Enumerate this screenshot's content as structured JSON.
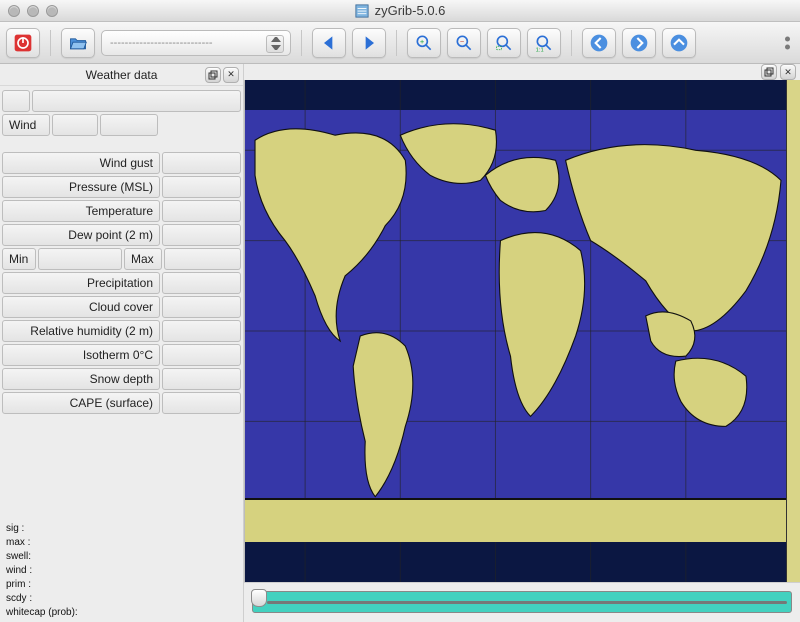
{
  "window": {
    "title": "zyGrib-5.0.6"
  },
  "toolbar": {
    "combo_placeholder": "----------------------------"
  },
  "sidebar": {
    "title": "Weather data",
    "rows": [
      {
        "label": "Wind"
      },
      {
        "label": "Wind gust"
      },
      {
        "label": "Pressure (MSL)"
      },
      {
        "label": "Temperature"
      },
      {
        "label": "Dew point (2 m)"
      },
      {
        "min_label": "Min",
        "max_label": "Max"
      },
      {
        "label": "Precipitation"
      },
      {
        "label": "Cloud cover"
      },
      {
        "label": "Relative humidity (2 m)"
      },
      {
        "label": "Isotherm 0°C"
      },
      {
        "label": "Snow depth"
      },
      {
        "label": "CAPE (surface)"
      }
    ],
    "legend": [
      "sig   :",
      "max  :",
      "swell:",
      "wind :",
      "prim :",
      "scdy :",
      "whitecap (prob):"
    ]
  }
}
